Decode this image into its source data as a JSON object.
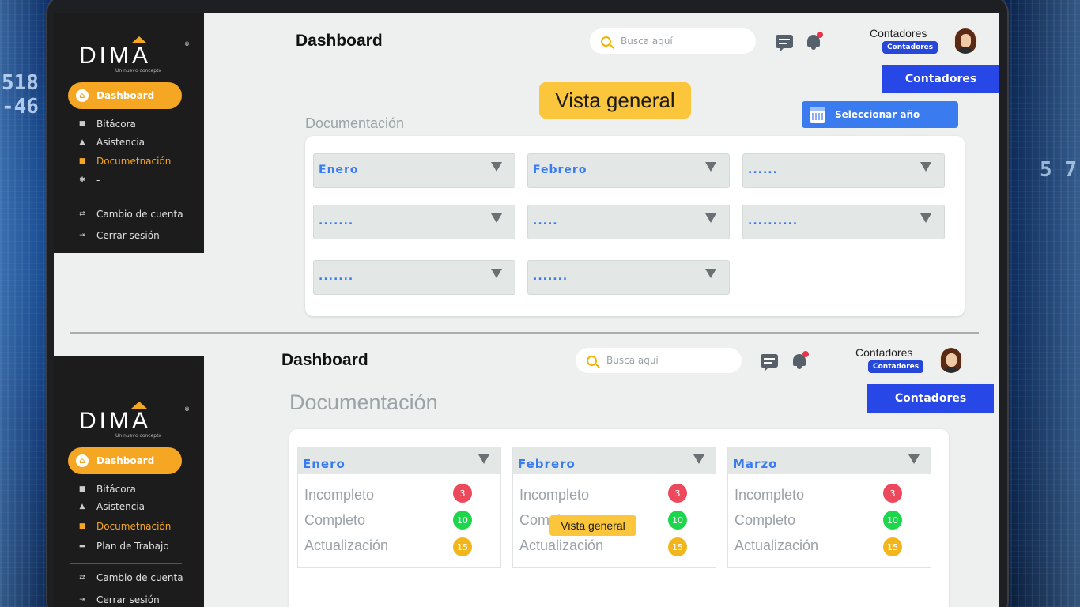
{
  "brand": {
    "name": "DIMA",
    "tagline": "Un nuevo concepto"
  },
  "sidebar_top": {
    "active": "Dashboard",
    "items": [
      "Bitácora",
      "Asistencia",
      "Documetnación",
      "-"
    ],
    "footer": [
      "Cambio de cuenta",
      "Cerrar sesión"
    ]
  },
  "sidebar_bottom": {
    "active": "Dashboard",
    "items": [
      "Bitácora",
      "Asistencia",
      "Documetnación",
      "Plan de Trabajo"
    ],
    "footer": [
      "Cambio de cuenta",
      "Cerrar sesión"
    ]
  },
  "header": {
    "title": "Dashboard",
    "search_placeholder": "Busca aquí",
    "user_name": "Contadores",
    "user_badge": "Contadores",
    "role_button": "Contadores"
  },
  "top": {
    "overview_badge": "Vista general",
    "year_button": "Seleccionar año",
    "section": "Documentación",
    "dropdowns": [
      "Enero",
      "Febrero",
      "......",
      ".......",
      ".....",
      "..........",
      ".......",
      "......."
    ]
  },
  "bottom": {
    "section": "Documentación",
    "overview_badge": "Vista general",
    "months": [
      {
        "name": "Enero",
        "rows": [
          {
            "label": "Incompleto",
            "count": "3"
          },
          {
            "label": "Completo",
            "count": "10"
          },
          {
            "label": "Actualización",
            "count": "15"
          }
        ]
      },
      {
        "name": "Febrero",
        "rows": [
          {
            "label": "Incompleto",
            "count": "3"
          },
          {
            "label": "Completo",
            "count": "10"
          },
          {
            "label": "Actualización",
            "count": "15"
          }
        ]
      },
      {
        "name": "Marzo",
        "rows": [
          {
            "label": "Incompleto",
            "count": "3"
          },
          {
            "label": "Completo",
            "count": "10"
          },
          {
            "label": "Actualización",
            "count": "15"
          }
        ]
      }
    ]
  },
  "colors": {
    "accent": "#f5a623",
    "primary": "#2747e6",
    "link": "#3a7cf0",
    "red": "#ec4a5c",
    "green": "#1ed64b",
    "orange": "#f2b51c"
  }
}
